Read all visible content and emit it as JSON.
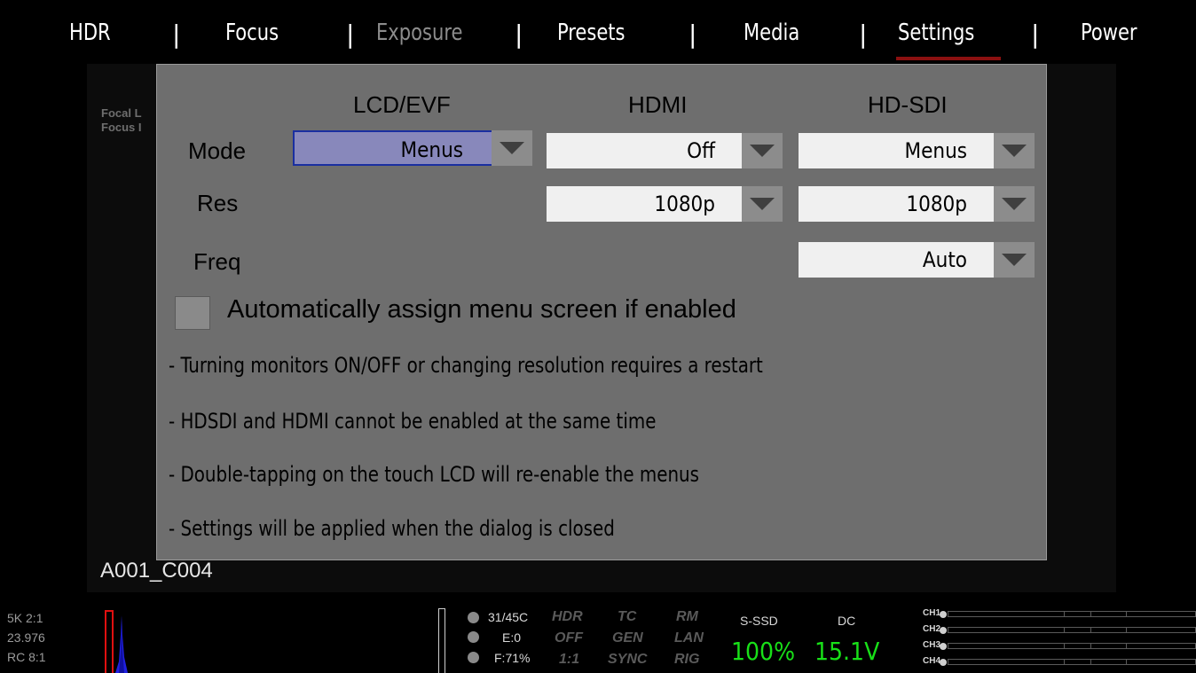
{
  "nav": {
    "items": [
      "HDR",
      "Focus",
      "Exposure",
      "Presets",
      "Media",
      "Settings",
      "Power"
    ],
    "separator": "|",
    "active": "Settings",
    "disabled": "Exposure",
    "active_underline_color": "#8b1010"
  },
  "background": {
    "label1": "Focal L",
    "label2": "Focus I",
    "clip_name": "A001_C004"
  },
  "dialog": {
    "columns": {
      "lcd": "LCD/EVF",
      "hdmi": "HDMI",
      "hdsdi": "HD-SDI"
    },
    "rows": {
      "mode": "Mode",
      "res": "Res",
      "freq": "Freq"
    },
    "mode": {
      "lcd": "Menus",
      "hdmi": "Off",
      "hdsdi": "Menus"
    },
    "res": {
      "hdmi": "1080p",
      "hdsdi": "1080p"
    },
    "freq": {
      "hdsdi": "Auto"
    },
    "auto_assign_label": "Automatically assign menu screen if enabled",
    "auto_assign_checked": false,
    "notes": [
      "- Turning monitors ON/OFF or changing resolution requires a restart",
      "- HDSDI and HDMI cannot be enabled at the same time",
      "- Double-tapping on the touch LCD will re-enable the menus",
      "- Settings will be applied when the dialog is closed"
    ],
    "active_dropdown_color": "#8888bb"
  },
  "status": {
    "format": "5K 2:1",
    "fps": "23.976",
    "compression": "RC 8:1",
    "temp": "31/45C",
    "exposure": "E:0",
    "focus": "F:71%",
    "hdr": "HDR",
    "off": "OFF",
    "ratio": "1:1",
    "tc": "TC",
    "gen": "GEN",
    "sync": "SYNC",
    "rm": "RM",
    "lan": "LAN",
    "rig": "RIG",
    "media_label": "S-SSD",
    "media_value": "100%",
    "power_label": "DC",
    "power_value": "15.1V",
    "channels": [
      "CH1",
      "CH2",
      "CH3",
      "CH4"
    ],
    "status_green": "#18e018"
  }
}
